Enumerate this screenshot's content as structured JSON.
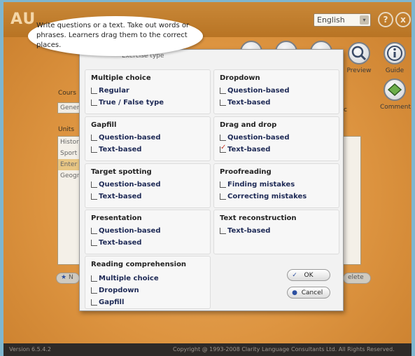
{
  "app": {
    "language": "English",
    "help_glyph": "?",
    "close_glyph": "x",
    "version": "Version 6.5.4.2",
    "copyright": "Copyright @ 1993-2008 Clarity Language Consultants Ltd. All Rights Reserved."
  },
  "background": {
    "course_label": "Cours",
    "course_value": "Gener",
    "units_label": "Units",
    "units": [
      "Histor",
      "Sport",
      "Enter",
      "Geogr"
    ],
    "tools": {
      "preview": "Preview",
      "guide": "Guide",
      "comment": "Comment"
    },
    "delete_label": "elete",
    "new_label": "N",
    "side_char": "c"
  },
  "tooltip": {
    "text": "Write questions or a text. Take out words or phrases. Learners drag them to the correct places."
  },
  "dialog": {
    "title": "Exercise type",
    "groups": {
      "multiple_choice": {
        "title": "Multiple choice",
        "options": [
          "Regular",
          "True / False type"
        ]
      },
      "dropdown": {
        "title": "Dropdown",
        "options": [
          "Question-based",
          "Text-based"
        ]
      },
      "gapfill": {
        "title": "Gapfill",
        "options": [
          "Question-based",
          "Text-based"
        ]
      },
      "drag_and_drop": {
        "title": "Drag and drop",
        "options": [
          "Question-based",
          "Text-based"
        ]
      },
      "target_spotting": {
        "title": "Target spotting",
        "options": [
          "Question-based",
          "Text-based"
        ]
      },
      "proofreading": {
        "title": "Proofreading",
        "options": [
          "Finding mistakes",
          "Correcting mistakes"
        ]
      },
      "presentation": {
        "title": "Presentation",
        "options": [
          "Question-based",
          "Text-based"
        ]
      },
      "text_reconstruction": {
        "title": "Text reconstruction",
        "options": [
          "Text-based"
        ]
      },
      "reading_comprehension": {
        "title": "Reading comprehension",
        "options": [
          "Multiple choice",
          "Dropdown",
          "Gapfill"
        ]
      }
    },
    "checked": "drag_and_drop.Text-based",
    "ok_label": "OK",
    "cancel_label": "Cancel"
  },
  "colors": {
    "accent": "#dd9440",
    "option_text": "#1e2a56",
    "check": "#c0392b"
  }
}
